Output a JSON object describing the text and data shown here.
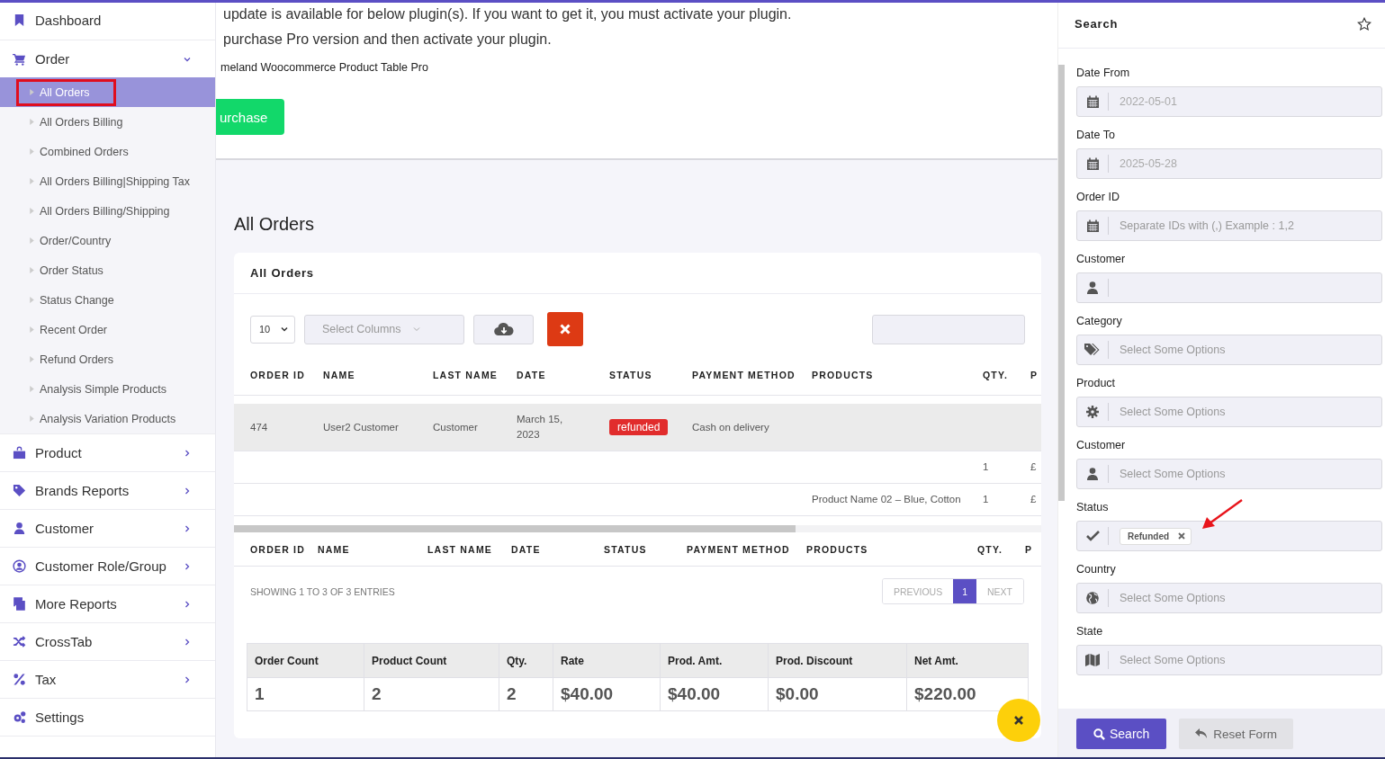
{
  "sidebar": {
    "items": [
      {
        "label": "Dashboard",
        "kind": "link"
      },
      {
        "label": "Order",
        "kind": "menu",
        "expanded": true,
        "children": [
          {
            "label": "All Orders",
            "selected": true
          },
          {
            "label": "All Orders Billing",
            "selected": false
          },
          {
            "label": "Combined Orders",
            "selected": false
          },
          {
            "label": "All Orders Billing|Shipping Tax",
            "selected": false
          },
          {
            "label": "All Orders Billing/Shipping",
            "selected": false
          },
          {
            "label": "Order/Country",
            "selected": false
          },
          {
            "label": "Order Status",
            "selected": false
          },
          {
            "label": "Status Change",
            "selected": false
          },
          {
            "label": "Recent Order",
            "selected": false
          },
          {
            "label": "Refund Orders",
            "selected": false
          },
          {
            "label": "Analysis Simple Products",
            "selected": false
          },
          {
            "label": "Analysis Variation Products",
            "selected": false
          }
        ]
      },
      {
        "label": "Product",
        "kind": "menu",
        "expanded": false
      },
      {
        "label": "Brands Reports",
        "kind": "menu",
        "expanded": false
      },
      {
        "label": "Customer",
        "kind": "menu",
        "expanded": false
      },
      {
        "label": "Customer Role/Group",
        "kind": "menu",
        "expanded": false
      },
      {
        "label": "More Reports",
        "kind": "menu",
        "expanded": false
      },
      {
        "label": "CrossTab",
        "kind": "menu",
        "expanded": false
      },
      {
        "label": "Tax",
        "kind": "menu",
        "expanded": false
      },
      {
        "label": "Settings",
        "kind": "link"
      }
    ]
  },
  "notice": {
    "lines": [
      "update is available for below plugin(s). If you want to get it, you must activate your plugin.",
      "purchase Pro version and then activate your plugin."
    ],
    "plugin": "meland Woocommerce Product Table Pro",
    "button": "urchase"
  },
  "page_title": "All Orders",
  "card": {
    "title": "All Orders",
    "toolbar": {
      "page_size": "10",
      "columns_placeholder": "Select Columns"
    },
    "table": {
      "columns": [
        {
          "label": "ORDER ID",
          "kind": "text"
        },
        {
          "label": "NAME",
          "kind": "text"
        },
        {
          "label": "LAST NAME",
          "kind": "text"
        },
        {
          "label": "DATE",
          "kind": "text"
        },
        {
          "label": "STATUS",
          "kind": "badge"
        },
        {
          "label": "PAYMENT METHOD",
          "kind": "text"
        },
        {
          "label": "PRODUCTS",
          "kind": "text"
        },
        {
          "label": "QTY.",
          "kind": "text"
        },
        {
          "label": "P",
          "kind": "text"
        }
      ],
      "rows": [
        {
          "selected": true,
          "cells": [
            "474",
            "User2 Customer",
            "Customer",
            "March 15, 2023",
            "refunded",
            "Cash on delivery",
            null,
            null,
            null
          ]
        },
        {
          "selected": false,
          "cells": [
            null,
            null,
            null,
            null,
            null,
            null,
            null,
            "1",
            "£"
          ]
        },
        {
          "selected": false,
          "cells": [
            null,
            null,
            null,
            null,
            null,
            null,
            "Product Name 02 – Blue, Cotton",
            "1",
            "£"
          ]
        }
      ],
      "footer_columns": [
        "ORDER ID",
        "NAME",
        "LAST NAME",
        "DATE",
        "STATUS",
        "PAYMENT METHOD",
        "PRODUCTS",
        "QTY.",
        "P"
      ]
    },
    "pagination": {
      "info": "SHOWING 1 TO 3 OF 3 ENTRIES",
      "previous": "PREVIOUS",
      "pages": [
        {
          "label": "1",
          "selected": true
        }
      ],
      "next": "NEXT"
    },
    "summary": {
      "columns": [
        "Order Count",
        "Product Count",
        "Qty.",
        "Rate",
        "Prod. Amt.",
        "Prod. Discount",
        "Net Amt."
      ],
      "values": [
        "1",
        "2",
        "2",
        "$40.00",
        "$40.00",
        "$0.00",
        "$220.00"
      ]
    }
  },
  "search_panel": {
    "title": "Search",
    "fields": [
      {
        "label": "Date From",
        "kind": "date",
        "value": "2022-05-01"
      },
      {
        "label": "Date To",
        "kind": "date",
        "value": "2025-05-28"
      },
      {
        "label": "Order ID",
        "kind": "date",
        "placeholder": "Separate IDs with (,) Example : 1,2"
      },
      {
        "label": "Customer",
        "kind": "user"
      },
      {
        "label": "Category",
        "kind": "tags",
        "placeholder": "Select Some Options"
      },
      {
        "label": "Product",
        "kind": "gear",
        "placeholder": "Select Some Options"
      },
      {
        "label": "Customer",
        "kind": "user",
        "placeholder": "Select Some Options"
      },
      {
        "label": "Status",
        "kind": "check",
        "chips": [
          "Refunded"
        ]
      },
      {
        "label": "Country",
        "kind": "globe",
        "placeholder": "Select Some Options"
      },
      {
        "label": "State",
        "kind": "map",
        "placeholder": "Select Some Options"
      }
    ],
    "search_button": "Search",
    "reset_button": "Reset Form"
  }
}
